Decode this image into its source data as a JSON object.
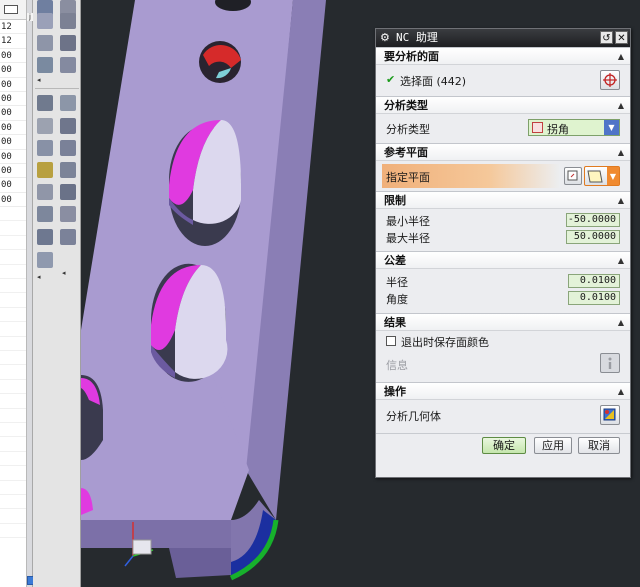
{
  "number_list": {
    "header_tag": "j",
    "rows": [
      "12",
      "12",
      "00",
      "00",
      "00",
      "00",
      "00",
      "00",
      "00",
      "00",
      "00",
      "00",
      "00"
    ]
  },
  "dialog": {
    "title": "NC 助理",
    "sections": {
      "face": {
        "header": "要分析的面",
        "select_label": "选择面 (442)",
        "select_icon": "crosshair-icon"
      },
      "analysis_type": {
        "header": "分析类型",
        "label": "分析类型",
        "selected": "拐角"
      },
      "reference_plane": {
        "header": "参考平面",
        "label": "指定平面"
      },
      "limits": {
        "header": "限制",
        "min_radius_label": "最小半径",
        "min_radius_value": "-50.0000",
        "max_radius_label": "最大半径",
        "max_radius_value": "50.0000"
      },
      "tolerance": {
        "header": "公差",
        "radius_label": "半径",
        "radius_value": "0.0100",
        "angle_label": "角度",
        "angle_value": "0.0100"
      },
      "results": {
        "header": "结果",
        "save_color_label": "退出时保存面颜色",
        "save_color_checked": false,
        "info_label": "信息"
      },
      "operations": {
        "header": "操作",
        "analyze_label": "分析几何体"
      }
    },
    "buttons": {
      "ok": "确定",
      "apply": "应用",
      "cancel": "取消"
    }
  },
  "colors": {
    "part": "#a99bd0",
    "highlight": "#ff00ff",
    "plane_row": "#f0b27a",
    "viewport_bg": "#262a2e"
  }
}
